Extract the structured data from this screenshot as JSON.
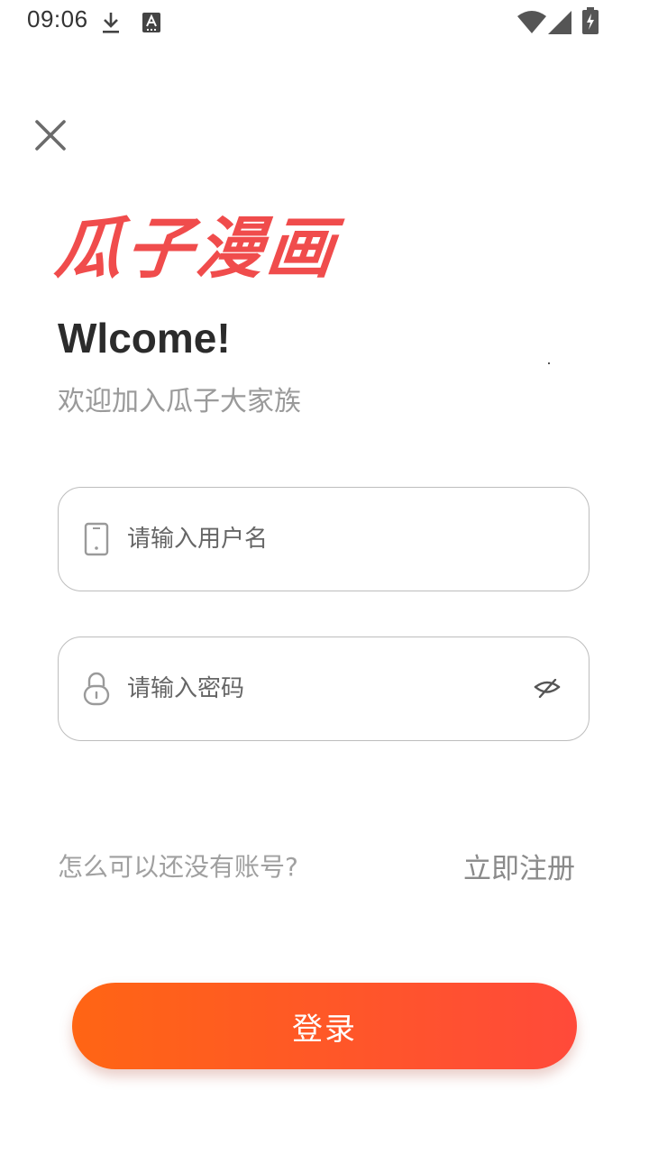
{
  "status_bar": {
    "time": "09:06",
    "icons": [
      "download-icon",
      "keyboard-a-icon",
      "wifi-icon",
      "signal-icon",
      "battery-charging-icon"
    ]
  },
  "header": {
    "close_icon": "close-icon"
  },
  "brand": {
    "logo_text": "瓜子漫画",
    "logo_color": "#f04c4c"
  },
  "welcome": {
    "title": "Wlcome!",
    "subtitle": "欢迎加入瓜子大家族"
  },
  "form": {
    "username": {
      "icon": "phone-icon",
      "placeholder": "请输入用户名",
      "value": ""
    },
    "password": {
      "icon": "lock-icon",
      "placeholder": "请输入密码",
      "value": "",
      "toggle_icon": "eye-off-icon"
    }
  },
  "register": {
    "prompt": "怎么可以还没有账号?",
    "link_label": "立即注册"
  },
  "login": {
    "button_label": "登录",
    "gradient_start": "#ff6514",
    "gradient_end": "#ff4a3a"
  }
}
